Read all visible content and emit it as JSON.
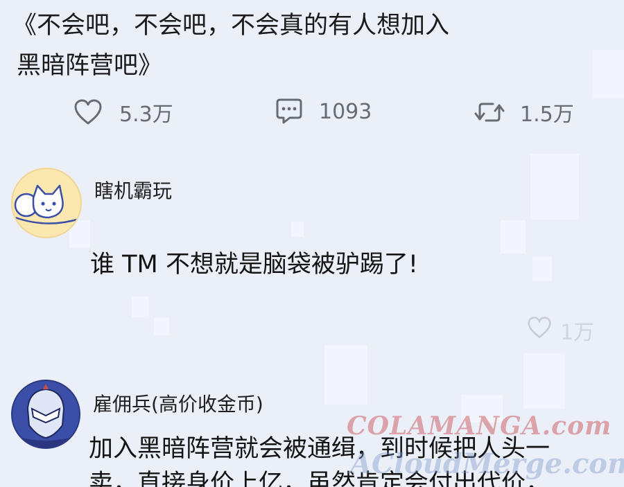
{
  "post": {
    "line1": "《不会吧，不会吧，不会真的有人想加入",
    "line2": "黑暗阵营吧》"
  },
  "actions": {
    "likes": "5.3万",
    "comments": "1093",
    "reposts": "1.5万"
  },
  "comments": [
    {
      "username": "瞎机霸玩",
      "text": "谁 TM 不想就是脑袋被驴踢了!",
      "likes": "1万"
    },
    {
      "username": "雇佣兵(高价收金币)",
      "text_line1": "加入黑暗阵营就会被通缉，到时候把人头一",
      "text_line2": "卖，直接身价上亿，虽然肯定会付出代价，"
    }
  ],
  "watermark": {
    "top": "COLAMANGA.com",
    "bottom": "ACloudMerge.com"
  },
  "colors": {
    "background": "#ebeff8",
    "icon_gray": "#666b74",
    "avatar1_bg": "#fbe8b0",
    "avatar2_bg": "#3b4fa8",
    "watermark_red": "#c8464a"
  }
}
